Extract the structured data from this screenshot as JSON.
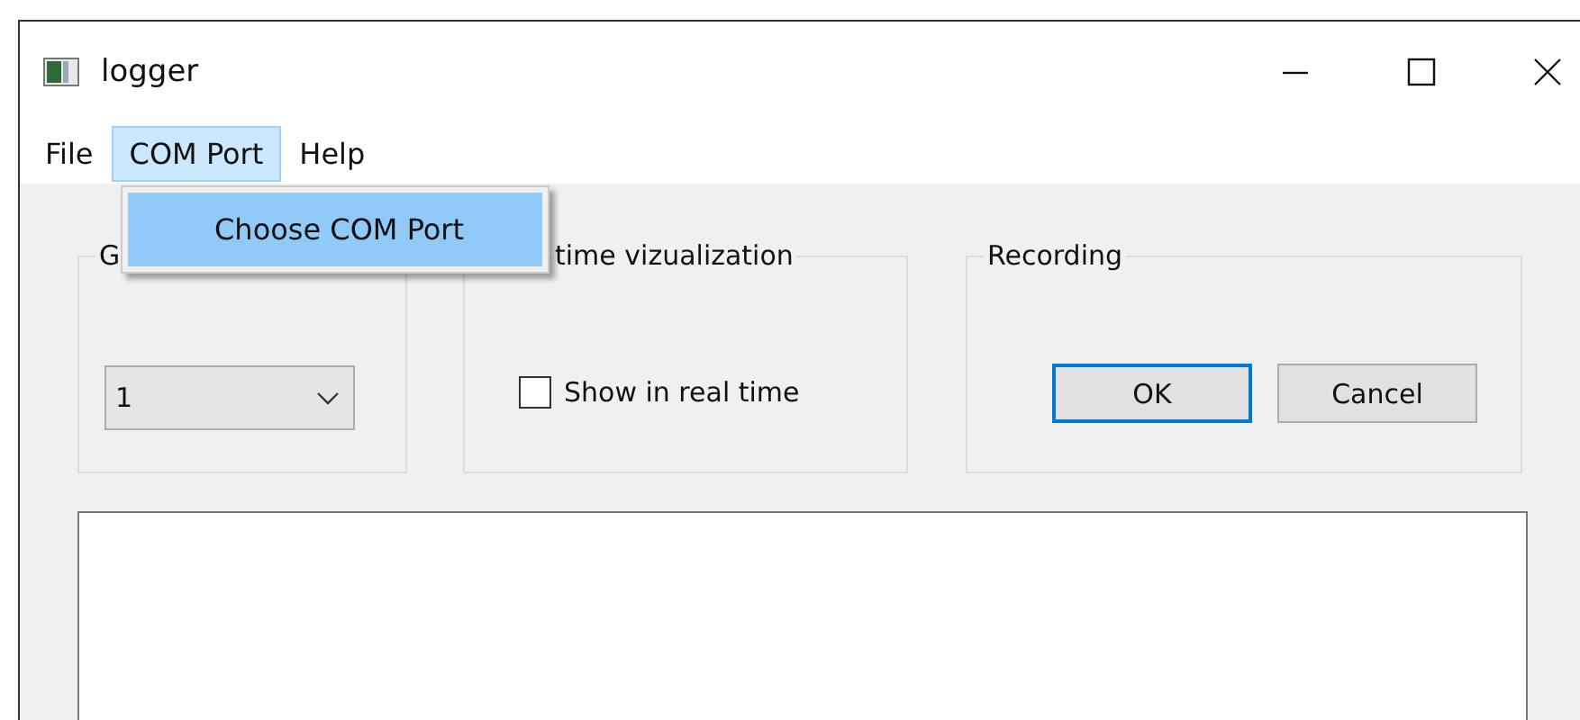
{
  "window": {
    "title": "logger"
  },
  "menu": [
    {
      "label": "File",
      "selected": false
    },
    {
      "label": "COM Port",
      "selected": true
    },
    {
      "label": "Help",
      "selected": false
    }
  ],
  "open_menu": {
    "items": [
      {
        "label": "Choose COM Port",
        "selected": true
      }
    ]
  },
  "groups": [
    {
      "kind": "combo",
      "title": "G",
      "value": "1"
    },
    {
      "kind": "checkbox",
      "title": "time vizualization",
      "checkbox": {
        "label": "Show in real time",
        "checked": false
      }
    },
    {
      "kind": "buttons",
      "title": "Recording",
      "buttons": [
        {
          "label": "OK",
          "default": true
        },
        {
          "label": "Cancel",
          "default": false
        }
      ]
    }
  ]
}
